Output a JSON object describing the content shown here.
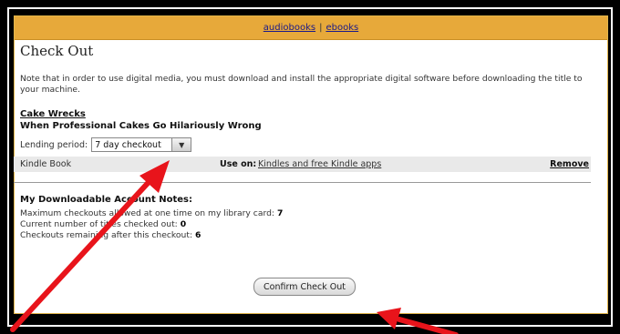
{
  "topbar": {
    "link_audiobooks": "audiobooks",
    "separator": "|",
    "link_ebooks": "ebooks"
  },
  "page": {
    "title": "Check Out",
    "note": "Note that in order to use digital media, you must download and install the appropriate digital software before downloading the title to your machine."
  },
  "book": {
    "title": "Cake Wrecks",
    "subtitle": "When Professional Cakes Go Hilariously Wrong",
    "lending_label": "Lending period:",
    "lending_value": "7 day checkout",
    "format": "Kindle Book",
    "use_on_label": "Use on:",
    "use_on_link": "Kindles and free Kindle apps",
    "remove_label": "Remove"
  },
  "account_notes": {
    "heading": "My Downloadable Account Notes:",
    "max_label": "Maximum checkouts allowed at one time on my library card:",
    "max_value": "7",
    "current_label": "Current number of titles checked out:",
    "current_value": "0",
    "remaining_label": "Checkouts remaining after this checkout:",
    "remaining_value": "6"
  },
  "confirm_button": "Confirm Check Out",
  "colors": {
    "topbar": "#e7a93a",
    "arrow": "#e8141b"
  }
}
